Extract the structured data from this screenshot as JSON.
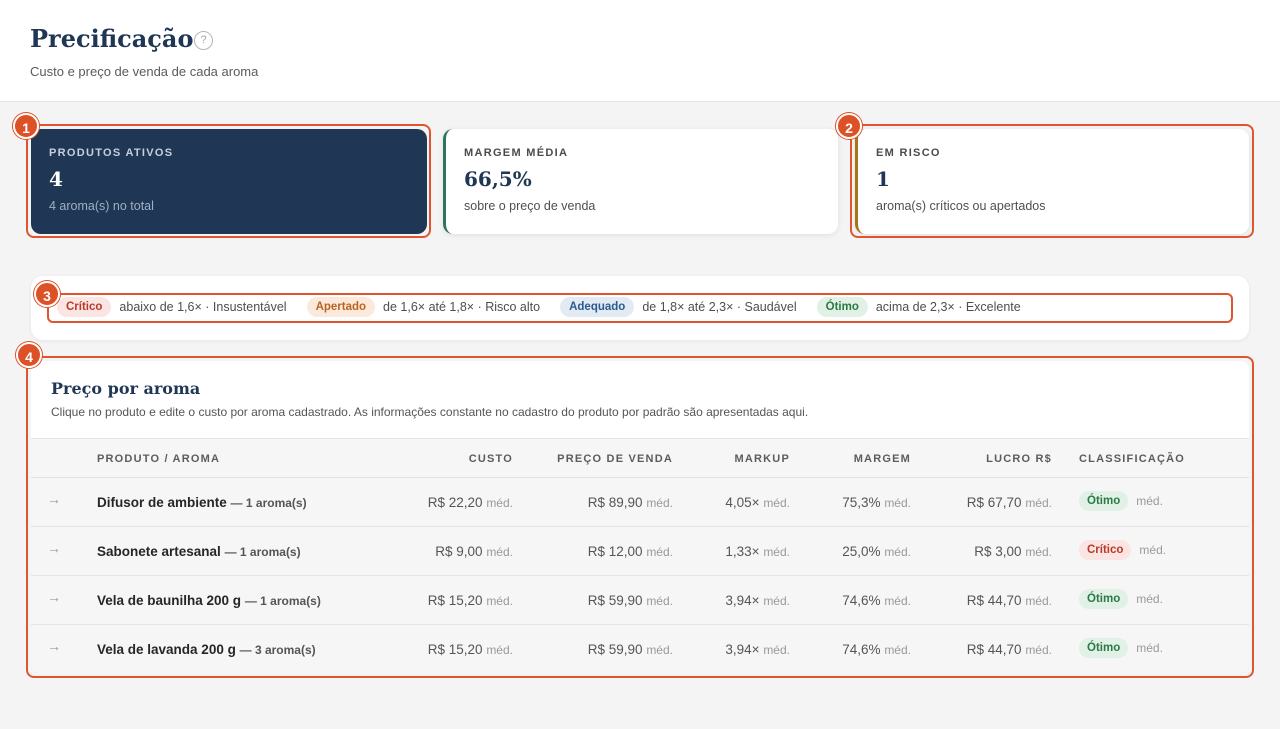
{
  "header": {
    "title": "Precificação",
    "help_icon": "question-circle-icon",
    "subtitle": "Custo e preço de venda de cada aroma"
  },
  "cards": [
    {
      "label": "PRODUTOS ATIVOS",
      "value": "4",
      "desc": "4 aroma(s) no total"
    },
    {
      "label": "MARGEM MÉDIA",
      "value": "66,5%",
      "desc": "sobre o preço de venda"
    },
    {
      "label": "EM RISCO",
      "value": "1",
      "desc": "aroma(s) críticos ou apertados"
    }
  ],
  "legend": [
    {
      "tag": "Crítico",
      "desc": "abaixo de 1,6× · Insustentável"
    },
    {
      "tag": "Apertado",
      "desc": "de 1,6× até 1,8× · Risco alto"
    },
    {
      "tag": "Adequado",
      "desc": "de 1,8× até 2,3× · Saudável"
    },
    {
      "tag": "Ótimo",
      "desc": "acima de 2,3× · Excelente"
    }
  ],
  "table": {
    "title": "Preço por aroma",
    "desc": "Clique no produto e edite o custo por aroma cadastrado. As informações constante no cadastro do produto por padrão são apresentadas aqui.",
    "columns": [
      "PRODUTO / AROMA",
      "CUSTO",
      "PREÇO DE VENDA",
      "MARKUP",
      "MARGEM",
      "LUCRO R$",
      "CLASSIFICAÇÃO"
    ],
    "med_label": "méd.",
    "arrow": "→",
    "rows": [
      {
        "product": "Difusor de ambiente",
        "aroma": "— 1 aroma(s)",
        "cost": "R$ 22,20",
        "price": "R$ 89,90",
        "markup": "4,05×",
        "margin": "75,3%",
        "profit": "R$ 67,70",
        "class": "Ótimo"
      },
      {
        "product": "Sabonete artesanal",
        "aroma": "— 1 aroma(s)",
        "cost": "R$ 9,00",
        "price": "R$ 12,00",
        "markup": "1,33×",
        "margin": "25,0%",
        "profit": "R$ 3,00",
        "class": "Crítico"
      },
      {
        "product": "Vela de baunilha 200 g",
        "aroma": "— 1 aroma(s)",
        "cost": "R$ 15,20",
        "price": "R$ 59,90",
        "markup": "3,94×",
        "margin": "74,6%",
        "profit": "R$ 44,70",
        "class": "Ótimo"
      },
      {
        "product": "Vela de lavanda 200 g",
        "aroma": "— 3 aroma(s)",
        "cost": "R$ 15,20",
        "price": "R$ 59,90",
        "markup": "3,94×",
        "margin": "74,6%",
        "profit": "R$ 44,70",
        "class": "Ótimo"
      }
    ]
  },
  "annotations": [
    "1",
    "2",
    "3",
    "4"
  ],
  "colors": {
    "navy": "#1f3654",
    "accent_orange": "#dd5127",
    "margin_accent": "#2e7560",
    "risk_accent": "#a4741c"
  }
}
